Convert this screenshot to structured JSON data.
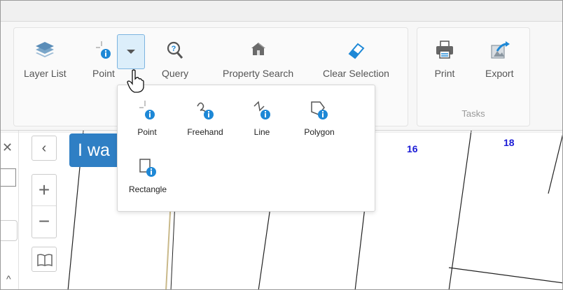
{
  "ribbon": {
    "tools": [
      {
        "label": "Layer List",
        "icon": "layers-icon"
      },
      {
        "label": "Point",
        "icon": "point-info-icon"
      },
      {
        "label": "Query",
        "icon": "query-magnifier-icon"
      },
      {
        "label": "Property Search",
        "icon": "house-icon"
      },
      {
        "label": "Clear Selection",
        "icon": "eraser-icon"
      }
    ],
    "tasks": {
      "label": "Tasks",
      "tools": [
        {
          "label": "Print",
          "icon": "printer-icon"
        },
        {
          "label": "Export",
          "icon": "export-icon"
        }
      ]
    }
  },
  "dropdown": {
    "options": [
      {
        "label": "Point",
        "icon": "point-info-icon"
      },
      {
        "label": "Freehand",
        "icon": "freehand-info-icon"
      },
      {
        "label": "Line",
        "icon": "line-info-icon"
      },
      {
        "label": "Polygon",
        "icon": "polygon-info-icon"
      },
      {
        "label": "Rectangle",
        "icon": "rectangle-info-icon"
      }
    ]
  },
  "map": {
    "banner_text": "I wa",
    "parcel_labels": [
      "16",
      "18"
    ]
  },
  "colors": {
    "accent": "#2f7fc4",
    "info_blue": "#1e88d6",
    "parcel_label": "#1a1ad6",
    "dropdown_active": "#dceefa"
  }
}
